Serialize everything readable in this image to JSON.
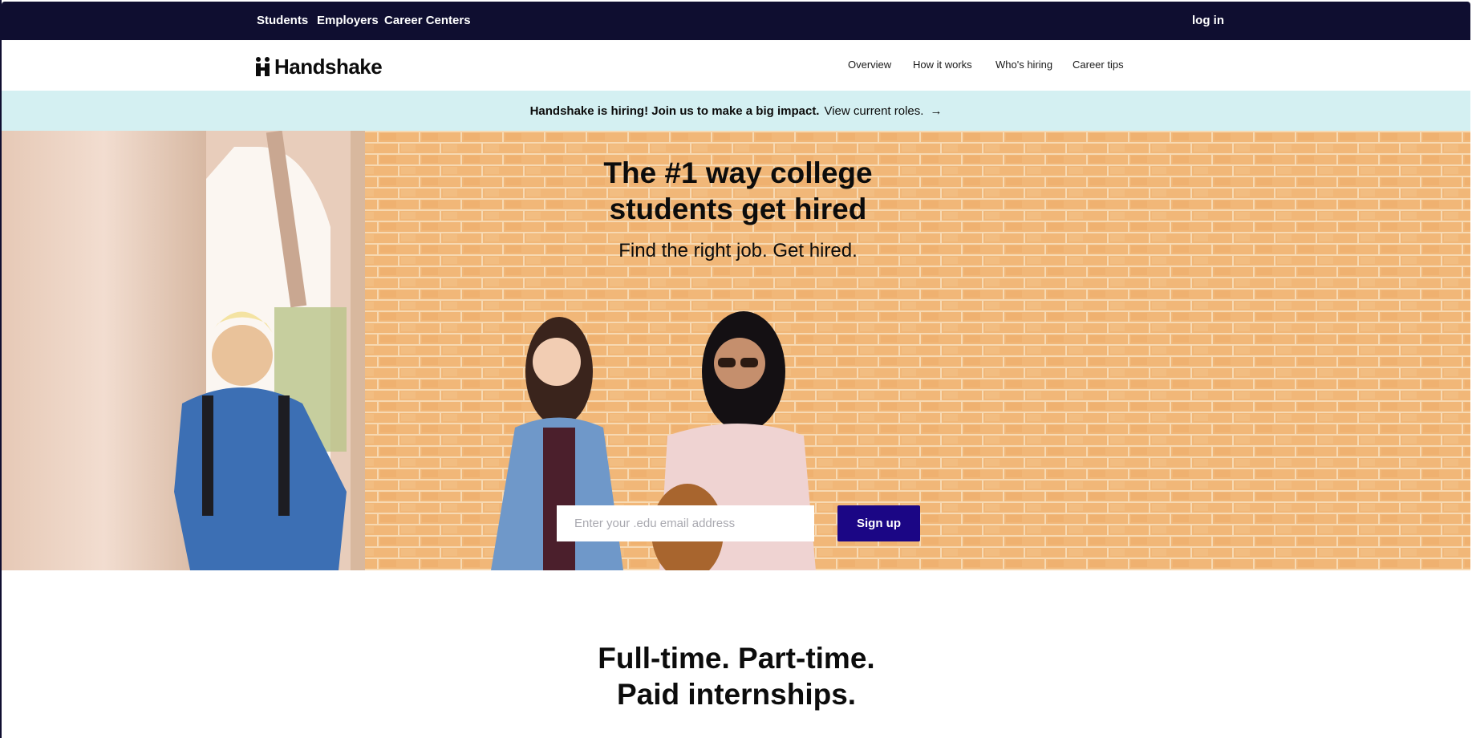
{
  "topbar": {
    "links": [
      "Students",
      "Employers",
      "Career Centers"
    ],
    "login": "log in"
  },
  "nav": {
    "brand": "Handshake",
    "items": [
      "Overview",
      "How it works",
      "Who's hiring",
      "Career tips"
    ]
  },
  "banner": {
    "bold_text": "Handshake is hiring! Join us to make a big impact.",
    "link_text": "View current roles.",
    "arrow": "→"
  },
  "hero": {
    "title_line1": "The #1 way college",
    "title_line2": "students get hired",
    "subtitle": "Find the right job. Get hired.",
    "email_placeholder": "Enter your .edu email address",
    "signup_label": "Sign up"
  },
  "section": {
    "title_line1": "Full-time. Part-time.",
    "title_line2": "Paid internships."
  },
  "colors": {
    "topbar_bg": "#0f0e30",
    "banner_bg": "#d4f0f2",
    "signup_bg": "#1b0685",
    "brick": "#f1b778"
  }
}
